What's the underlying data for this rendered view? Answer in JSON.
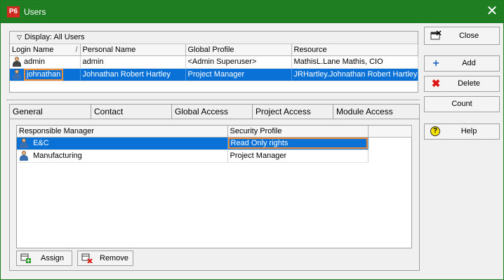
{
  "window": {
    "app_logo": "P6",
    "title": "Users",
    "close_glyph": "✕"
  },
  "users": {
    "display_label": "Display: All Users",
    "columns": [
      "Login Name",
      "Personal Name",
      "Global Profile",
      "Resource"
    ],
    "sort_indicator": "/",
    "rows": [
      {
        "login": "admin",
        "personal": "admin",
        "profile": "<Admin Superuser>",
        "resource": "MathisL.Lane Mathis, CIO"
      },
      {
        "login": "johnathan",
        "personal": "Johnathan Robert Hartley",
        "profile": "Project Manager",
        "resource": "JRHartley.Johnathan Robert Hartley"
      }
    ]
  },
  "tabs": [
    "General",
    "Contact",
    "Global Access",
    "Project Access",
    "Module Access"
  ],
  "project_access": {
    "columns": [
      "Responsible Manager",
      "Security Profile"
    ],
    "rows": [
      {
        "manager": "E&C",
        "security": "Read Only rights"
      },
      {
        "manager": "Manufacturing",
        "security": "Project Manager"
      }
    ],
    "assign_label": "Assign",
    "remove_label": "Remove"
  },
  "side_buttons": {
    "close": "Close",
    "add": "Add",
    "delete": "Delete",
    "count": "Count",
    "help": "Help"
  },
  "colors": {
    "titlebar": "#1f7e22",
    "selection": "#0a72d6",
    "focus": "#e98b3a",
    "logo": "#d12a1e"
  }
}
